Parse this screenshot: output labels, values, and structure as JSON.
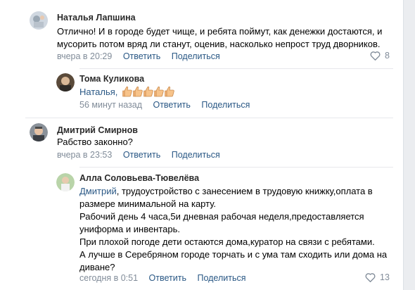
{
  "comments": [
    {
      "author": "Наталья Лапшина",
      "lines": [
        "Отлично! И в городе будет чище, и ребята поймут, как денежки достаются, и",
        "мусорить потом вряд ли станут, оценив, насколько непрост труд дворников."
      ],
      "time": "вчера в 20:29",
      "reply_label": "Ответить",
      "share_label": "Поделиться",
      "likes": "8"
    },
    {
      "author": "Тома Куликова",
      "reply_to": "Наталья,",
      "emoji": "👍👍👍👍👍",
      "time": "56 минут назад",
      "reply_label": "Ответить",
      "share_label": "Поделиться"
    },
    {
      "author": "Дмитрий Смирнов",
      "lines": [
        "Рабство законно?"
      ],
      "time": "вчера в 23:53",
      "reply_label": "Ответить",
      "share_label": "Поделиться"
    },
    {
      "author": "Алла Соловьева-Тювелёва",
      "reply_to": "Дмитрий",
      "first_line_rest": ", трудоустройство с занесением в трудовую книжку,оплата в",
      "lines": [
        "размере минимальной на карту.",
        "Рабочий день 4 часа,5и дневная рабочая неделя,предоставляется",
        "униформа и инвентарь.",
        "При плохой погоде дети остаются дома,куратор на связи с ребятами.",
        "А лучше в Серебряном городе торчать и с ума там сходить или дома на",
        "диване?"
      ],
      "time": "сегодня в 0:51",
      "reply_label": "Ответить",
      "share_label": "Поделиться",
      "likes": "13"
    }
  ],
  "colors": {
    "link": "#2a5885",
    "meta": "#818c99",
    "like": "#818c99"
  }
}
